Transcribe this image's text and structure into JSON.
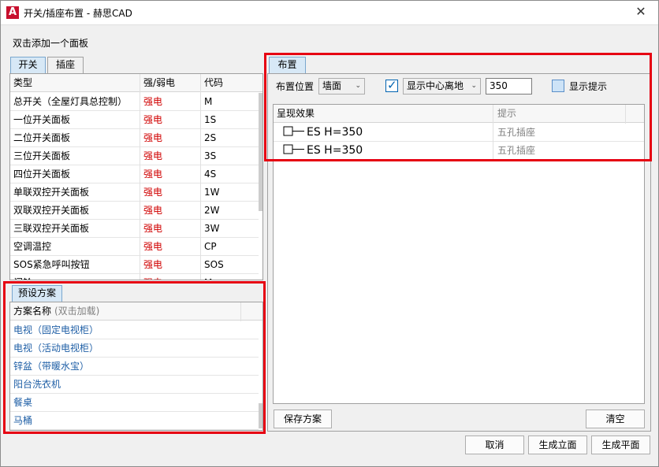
{
  "window": {
    "title": "开关/插座布置 - 赫思CAD",
    "app_icon": "A",
    "close_glyph": "✕"
  },
  "hint": "双击添加一个面板",
  "tabs": [
    {
      "label": "开关",
      "active": true
    },
    {
      "label": "插座",
      "active": false
    }
  ],
  "switch_table": {
    "headers": [
      "类型",
      "强/弱电",
      "代码"
    ],
    "rows": [
      {
        "type": "总开关（全屋灯具总控制）",
        "power": "强电",
        "code": "M"
      },
      {
        "type": "一位开关面板",
        "power": "强电",
        "code": "1S"
      },
      {
        "type": "二位开关面板",
        "power": "强电",
        "code": "2S"
      },
      {
        "type": "三位开关面板",
        "power": "强电",
        "code": "3S"
      },
      {
        "type": "四位开关面板",
        "power": "强电",
        "code": "4S"
      },
      {
        "type": "单联双控开关面板",
        "power": "强电",
        "code": "1W"
      },
      {
        "type": "双联双控开关面板",
        "power": "强电",
        "code": "2W"
      },
      {
        "type": "三联双控开关面板",
        "power": "强电",
        "code": "3W"
      },
      {
        "type": "空调温控",
        "power": "强电",
        "code": "CP"
      },
      {
        "type": "SOS紧急呼叫按钮",
        "power": "强电",
        "code": "SOS"
      },
      {
        "type": "门铃",
        "power": "强电",
        "code": "M"
      }
    ]
  },
  "preset": {
    "tab_label": "预设方案",
    "header_name": "方案名称",
    "header_hint": "(双击加载)",
    "items": [
      "电视（固定电视柜）",
      "电视（活动电视柜）",
      "锌盆（带暖水宝）",
      "阳台洗衣机",
      "餐桌",
      "马桶"
    ]
  },
  "layout": {
    "tab_label": "布置",
    "position_label": "布置位置",
    "position_value": "墙面",
    "show_center_checked": true,
    "show_center_option": "显示中心离地",
    "height_value": "350",
    "show_hint_label": "显示提示",
    "show_hint_checked": false,
    "result_headers": [
      "呈现效果",
      "提示"
    ],
    "results": [
      {
        "effect": "ES H=350",
        "hint": "五孔插座"
      },
      {
        "effect": "ES H=350",
        "hint": "五孔插座"
      }
    ],
    "save_button": "保存方案",
    "clear_button": "清空"
  },
  "footer": {
    "cancel": "取消",
    "elevation": "生成立面",
    "plan": "生成平面"
  },
  "colors": {
    "highlight_box": "#e60012",
    "strong_power_text": "#d00000",
    "preset_link_text": "#1f5fa6"
  }
}
